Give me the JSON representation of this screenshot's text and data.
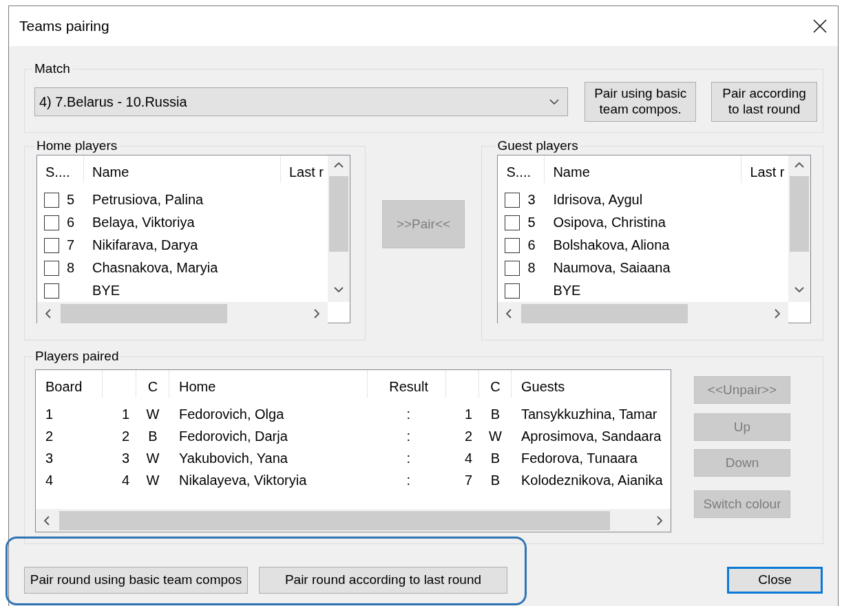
{
  "window": {
    "title": "Teams pairing"
  },
  "match": {
    "legend": "Match",
    "value": "4) 7.Belarus - 10.Russia",
    "buttons": [
      {
        "label": "Pair using basic team compos.",
        "disabled": false
      },
      {
        "label": "Pair according to last round",
        "disabled": false
      }
    ]
  },
  "home": {
    "legend": "Home players",
    "columns": [
      "S....",
      "Name",
      "Last r"
    ],
    "rows": [
      {
        "number": "5",
        "name": "Petrusiova, Palina",
        "checked": false
      },
      {
        "number": "6",
        "name": "Belaya, Viktoriya",
        "checked": false
      },
      {
        "number": "7",
        "name": "Nikifarava, Darya",
        "checked": false
      },
      {
        "number": "8",
        "name": "Chasnakova, Maryia",
        "checked": false
      },
      {
        "name": "BYE",
        "checked": false
      }
    ]
  },
  "pair_button": {
    "label": ">>Pair<<",
    "disabled": true
  },
  "guest": {
    "legend": "Guest players",
    "columns": [
      "S....",
      "Name",
      "Last r"
    ],
    "rows": [
      {
        "number": "3",
        "name": "Idrisova, Aygul",
        "checked": false
      },
      {
        "number": "5",
        "name": "Osipova, Christina",
        "checked": false
      },
      {
        "number": "6",
        "name": "Bolshakova, Aliona",
        "checked": false
      },
      {
        "number": "8",
        "name": "Naumova, Saiaana",
        "checked": false
      },
      {
        "name": "BYE",
        "checked": false
      }
    ]
  },
  "paired": {
    "legend": "Players paired",
    "columns": [
      "Board",
      "C",
      "Home",
      "Result",
      "C",
      "Guests"
    ],
    "rows": [
      {
        "board": "1",
        "home_no": "1",
        "home_colour": "W",
        "home": "Fedorovich, Olga",
        "result": ":",
        "guest_no": "1",
        "guest_colour": "B",
        "guest": "Tansykkuzhina, Tamar"
      },
      {
        "board": "2",
        "home_no": "2",
        "home_colour": "B",
        "home": "Fedorovich, Darja",
        "result": ":",
        "guest_no": "2",
        "guest_colour": "W",
        "guest": "Aprosimova, Sandaara"
      },
      {
        "board": "3",
        "home_no": "3",
        "home_colour": "W",
        "home": "Yakubovich, Yana",
        "result": ":",
        "guest_no": "4",
        "guest_colour": "B",
        "guest": "Fedorova, Tunaara"
      },
      {
        "board": "4",
        "home_no": "4",
        "home_colour": "W",
        "home": "Nikalayeva, Viktoryia",
        "result": ":",
        "guest_no": "7",
        "guest_colour": "B",
        "guest": "Kolodeznikova, Aianika"
      }
    ],
    "buttons": [
      {
        "label": "<<Unpair>>",
        "disabled": true
      },
      {
        "label": "Up",
        "disabled": true
      },
      {
        "label": "Down",
        "disabled": true
      },
      {
        "label": "Switch colour",
        "disabled": true
      }
    ]
  },
  "bottom": {
    "highlighted": true,
    "buttons": [
      {
        "label": "Pair round using basic team compos",
        "disabled": false
      },
      {
        "label": "Pair round according to last round",
        "disabled": false
      }
    ]
  },
  "close_button": {
    "label": "Close",
    "default": true
  }
}
